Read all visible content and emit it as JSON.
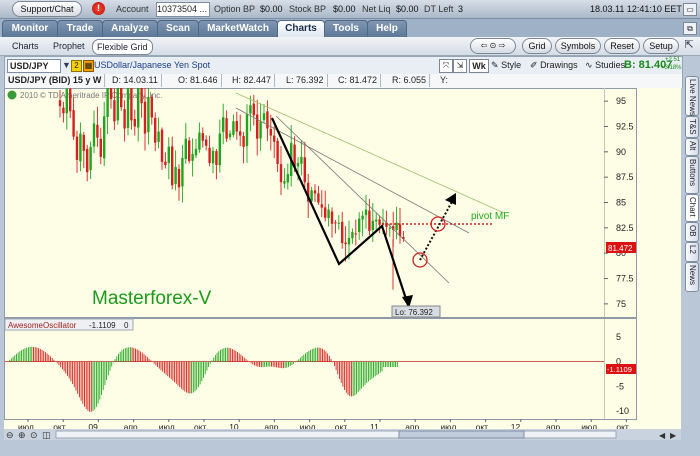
{
  "topbar": {
    "support_label": "Support/Chat",
    "alert_icon": "exclamation-icon",
    "account_label": "Account",
    "account_value": "10373504 ...",
    "option_bp_label": "Option BP",
    "option_bp_value": "$0.00",
    "stock_bp_label": "Stock BP",
    "stock_bp_value": "$0.00",
    "net_liq_label": "Net Liq",
    "net_liq_value": "$0.00",
    "dt_left_label": "DT Left",
    "dt_left_value": "3",
    "datetime": "18.03.11 12:41:10 EET"
  },
  "tabs": [
    {
      "label": "Monitor"
    },
    {
      "label": "Trade"
    },
    {
      "label": "Analyze"
    },
    {
      "label": "Scan"
    },
    {
      "label": "MarketWatch"
    },
    {
      "label": "Charts"
    },
    {
      "label": "Tools"
    },
    {
      "label": "Help"
    }
  ],
  "subtabs": [
    "Charts",
    "Prophet",
    "Flexible Grid"
  ],
  "subtoolbar": {
    "grid": "Grid",
    "symbols": "Symbols",
    "reset": "Reset",
    "setup": "Setup"
  },
  "chart_header": {
    "symbol": "USD/JPY",
    "symbol_badge": "2",
    "symbol_desc": "USDollar/Japanese Yen Spot",
    "wk": "Wk",
    "style": "Style",
    "drawings": "Drawings",
    "studies": "Studies",
    "bid": "B: 81.407",
    "change": "+2.51",
    "change_pct": "+3.18%"
  },
  "infobar": {
    "title": "USD/JPY (BID) 15 y W",
    "date": "D: 14.03.11",
    "open": "O: 81.646",
    "high": "H: 82.447",
    "low": "L: 76.392",
    "close": "C: 81.472",
    "range": "R: 6.055",
    "y": "Y:"
  },
  "right_tabs": [
    "Live News",
    "T&S",
    "Alt",
    "Buttons",
    "Chart",
    "OB",
    "L2",
    "News"
  ],
  "chart_data": {
    "type": "candlestick",
    "copyright": "2010 © TD Ameritrade IP Company, Inc.",
    "watermark": "Masterforex-V",
    "price_axis": {
      "ticks": [
        95,
        92.5,
        90,
        87.5,
        85,
        82.5,
        80,
        77.5,
        75
      ],
      "range": [
        74,
        96
      ]
    },
    "current_price_badge": "81.472",
    "low_label": "Lo: 76.392",
    "annotation": "pivot MF",
    "x_labels": [
      "июл",
      "окт",
      "09",
      "апр",
      "июл",
      "окт",
      "10",
      "апр",
      "июл",
      "окт",
      "11",
      "апр",
      "июл",
      "окт",
      "12",
      "апр",
      "июл",
      "окт"
    ],
    "series_close": [
      94.5,
      93.8,
      96.2,
      94.0,
      91.5,
      89.2,
      91.8,
      90.1,
      88.0,
      90.5,
      92.8,
      91.4,
      89.5,
      93.5,
      96.8,
      95.2,
      93.0,
      97.5,
      94.4,
      92.3,
      96.3,
      93.1,
      92.5,
      97.0,
      94.8,
      91.8,
      95.4,
      93.4,
      90.9,
      92.0,
      89.0,
      88.7,
      90.5,
      86.7,
      88.5,
      86.5,
      89.4,
      91.3,
      89.1,
      89.8,
      90.3,
      91.9,
      91.1,
      90.6,
      88.9,
      90.1,
      88.7,
      91.8,
      93.4,
      91.3,
      91.8,
      93.0,
      92.0,
      91.6,
      90.5,
      93.7,
      94.6,
      93.6,
      91.3,
      93.0,
      93.8,
      92.3,
      91.6,
      91.0,
      88.8,
      87.0,
      87.1,
      87.8,
      90.9,
      88.5,
      88.9,
      89.5,
      87.0,
      85.1,
      86.2,
      85.9,
      85.0,
      84.5,
      83.5,
      84.3,
      82.9,
      83.0,
      83.0,
      81.0,
      80.9,
      81.5,
      82.1,
      81.9,
      83.4,
      83.7,
      84.3,
      82.2,
      83.2,
      83.3,
      82.8,
      83.0,
      82.6,
      82.5,
      82.3,
      83.0,
      81.7,
      81.4
    ],
    "oscillator": {
      "name": "AwesomeOscillator",
      "value": "-1.1109",
      "param": "0",
      "badge": "-1.1109",
      "ticks": [
        5,
        0,
        -5,
        -10
      ],
      "range": [
        -11,
        6
      ]
    }
  }
}
